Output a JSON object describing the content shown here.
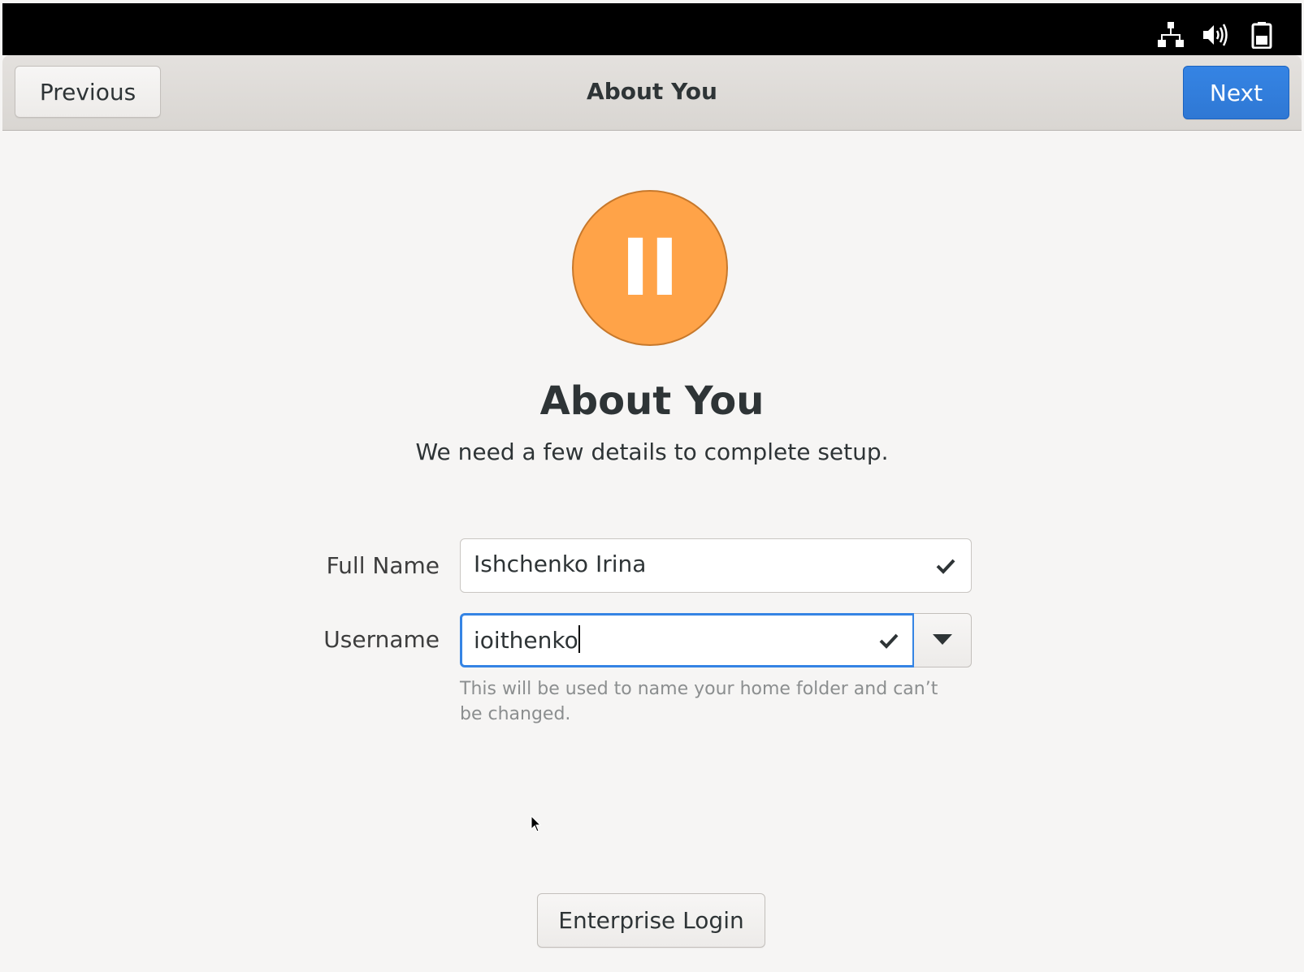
{
  "system_bar": {
    "icons": [
      "network-icon",
      "volume-icon",
      "battery-icon"
    ]
  },
  "header": {
    "previous_label": "Previous",
    "title": "About You",
    "next_label": "Next"
  },
  "avatar": {
    "initials": "II",
    "color": "#ffa348"
  },
  "main": {
    "title": "About You",
    "subtitle": "We need a few details to complete setup."
  },
  "form": {
    "full_name_label": "Full Name",
    "full_name_value": "Ishchenko Irina",
    "username_label": "Username",
    "username_value": "ioithenko",
    "username_hint": "This will be used to name your home folder and can’t be changed."
  },
  "footer": {
    "enterprise_login_label": "Enterprise Login"
  },
  "colors": {
    "accent": "#3584e4",
    "background": "#f6f5f4",
    "text": "#2e3436"
  }
}
